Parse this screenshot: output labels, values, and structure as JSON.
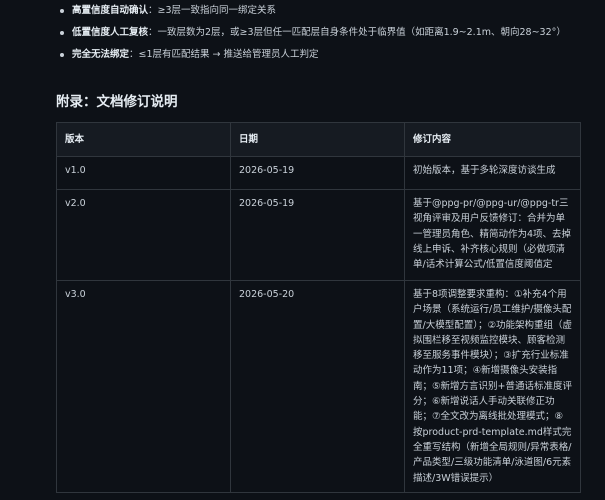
{
  "bullets": [
    {
      "label": "高置信度自动确认",
      "text": "：≥3层一致指向同一绑定关系"
    },
    {
      "label": "低置信度人工复核",
      "text": "：一致层数为2层，或≥3层但任一匹配层自身条件处于临界值（如距离1.9~2.1m、朝向28~32°）"
    },
    {
      "label": "完全无法绑定",
      "text": "：≤1层有匹配结果 → 推送给管理员人工判定"
    }
  ],
  "appendix": {
    "title": "附录：文档修订说明",
    "headers": [
      "版本",
      "日期",
      "修订内容"
    ],
    "rows": [
      {
        "version": "v1.0",
        "date": "2026-05-19",
        "content": "初始版本，基于多轮深度访谈生成"
      },
      {
        "version": "v2.0",
        "date": "2026-05-19",
        "content": "基于@ppg-pr/@ppg-ur/@ppg-tr三视角评审及用户反馈修订：合并为单一管理员角色、精简动作为4项、去掉线上申诉、补齐核心规则（必做项清单/话术计算公式/低置信度阈值定义）、补充异常流程和错误提示、强化人工确认机制"
      },
      {
        "version": "v3.0",
        "date": "2026-05-20",
        "content": "基于8项调整要求重构：①补充4个用户场景（系统运行/员工维护/摄像头配置/大模型配置）；②功能架构重组（虚拟围栏移至视频监控模块、顾客检测移至服务事件模块）；③扩充行业标准动作为11项；④新增摄像头安装指南；⑤新增方言识别+普通话标准度评分；⑥新增说话人手动关联修正功能；⑦全文改为离线批处理模式；⑧按product-prd-template.md样式完全重写结构（新增全局规则/异常表格/产品类型/三级功能清单/泳道图/6元素描述/3W错误提示）"
      }
    ]
  }
}
